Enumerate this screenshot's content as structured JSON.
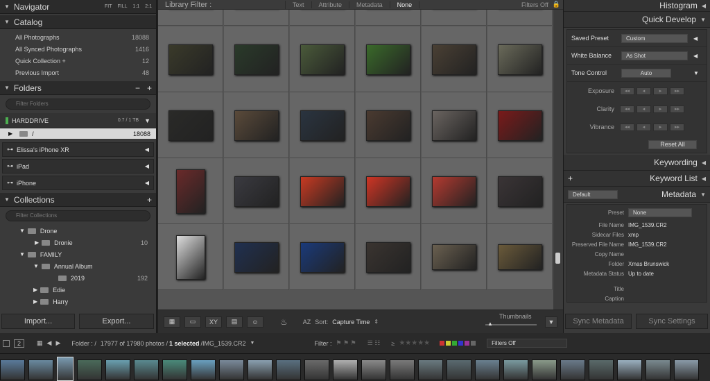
{
  "left": {
    "navigator": {
      "title": "Navigator",
      "zoom": [
        "FIT",
        "FILL",
        "1:1",
        "2:1"
      ]
    },
    "catalog": {
      "title": "Catalog",
      "items": [
        {
          "label": "All Photographs",
          "count": "18088"
        },
        {
          "label": "All Synced Photographs",
          "count": "1416"
        },
        {
          "label": "Quick Collection +",
          "count": "12"
        },
        {
          "label": "Previous Import",
          "count": "48"
        }
      ]
    },
    "folders": {
      "title": "Folders",
      "filter_placeholder": "Filter Folders",
      "volume": {
        "name": "HARDDRIVE",
        "size": "0.7 / 1 TB"
      },
      "root": {
        "label": "/",
        "count": "18088"
      },
      "devices": [
        "Elissa's iPhone XR",
        "iPad",
        "iPhone"
      ]
    },
    "collections": {
      "title": "Collections",
      "filter_placeholder": "Filter Collections",
      "items": [
        {
          "label": "Drone",
          "count": ""
        },
        {
          "label": "Dronie",
          "count": "10"
        },
        {
          "label": "FAMILY",
          "count": ""
        },
        {
          "label": "Annual Album",
          "count": ""
        },
        {
          "label": "2019",
          "count": "192"
        },
        {
          "label": "Edie",
          "count": ""
        },
        {
          "label": "Harry",
          "count": ""
        }
      ]
    },
    "import_label": "Import...",
    "export_label": "Export..."
  },
  "center": {
    "filter": {
      "title": "Library Filter :",
      "tabs": [
        "Text",
        "Attribute",
        "Metadata",
        "None"
      ],
      "preset": "Filters Off"
    },
    "toolbar": {
      "sort_label": "Sort:",
      "sort_value": "Capture Time",
      "thumbnails_label": "Thumbnails"
    }
  },
  "right": {
    "histogram": "Histogram",
    "quick_develop": "Quick Develop",
    "saved_preset": {
      "label": "Saved Preset",
      "value": "Custom"
    },
    "white_balance": {
      "label": "White Balance",
      "value": "As Shot"
    },
    "tone_control": {
      "label": "Tone Control",
      "value": "Auto"
    },
    "exposure": "Exposure",
    "clarity": "Clarity",
    "vibrance": "Vibrance",
    "reset": "Reset All",
    "keywording": "Keywording",
    "keyword_list": "Keyword List",
    "metadata_title": "Metadata",
    "metadata_default": "Default",
    "preset_label": "Preset",
    "preset_value": "None",
    "meta": [
      {
        "k": "File Name",
        "v": "IMG_1539.CR2"
      },
      {
        "k": "Sidecar Files",
        "v": "xmp"
      },
      {
        "k": "Preserved File Name",
        "v": "IMG_1539.CR2"
      },
      {
        "k": "Copy Name",
        "v": ""
      },
      {
        "k": "Folder",
        "v": "Xmas Brunswick"
      },
      {
        "k": "Metadata Status",
        "v": "Up to date"
      },
      {
        "k": "Title",
        "v": ""
      },
      {
        "k": "Caption",
        "v": ""
      }
    ],
    "sync_metadata": "Sync Metadata",
    "sync_settings": "Sync Settings"
  },
  "filmstrip": {
    "page": "2",
    "folder": "Folder : /",
    "count": "17977 of 17980 photos /",
    "selected": "1 selected",
    "file": "/IMG_1539.CR2",
    "filter_label": "Filter :",
    "filters_off": "Filters Off"
  },
  "colors": {
    "accent": "#d8d8d8",
    "panel": "#3a3a3a",
    "grid": "#555555",
    "red": "#d2321e"
  }
}
